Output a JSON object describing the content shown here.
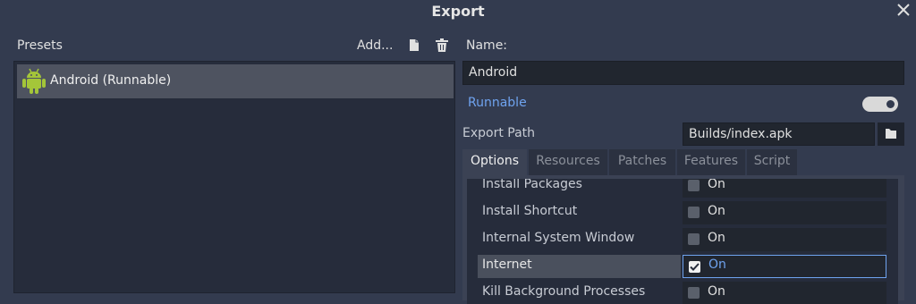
{
  "window": {
    "title": "Export"
  },
  "presets": {
    "label": "Presets",
    "add_label": "Add...",
    "items": [
      {
        "label": "Android (Runnable)"
      }
    ]
  },
  "details": {
    "name_label": "Name:",
    "name_value": "Android",
    "runnable_label": "Runnable",
    "export_path_label": "Export Path",
    "export_path_value": "Builds/index.apk"
  },
  "tabs": [
    "Options",
    "Resources",
    "Patches",
    "Features",
    "Script"
  ],
  "options": [
    {
      "label": "Install Packages",
      "value": "On",
      "checked": false
    },
    {
      "label": "Install Shortcut",
      "value": "On",
      "checked": false
    },
    {
      "label": "Internal System Window",
      "value": "On",
      "checked": false
    },
    {
      "label": "Internet",
      "value": "On",
      "checked": true
    },
    {
      "label": "Kill Background Processes",
      "value": "On",
      "checked": false
    }
  ],
  "colors": {
    "accent": "#6fa3ef",
    "background": "#333b4f",
    "android_green": "#a4c639"
  }
}
